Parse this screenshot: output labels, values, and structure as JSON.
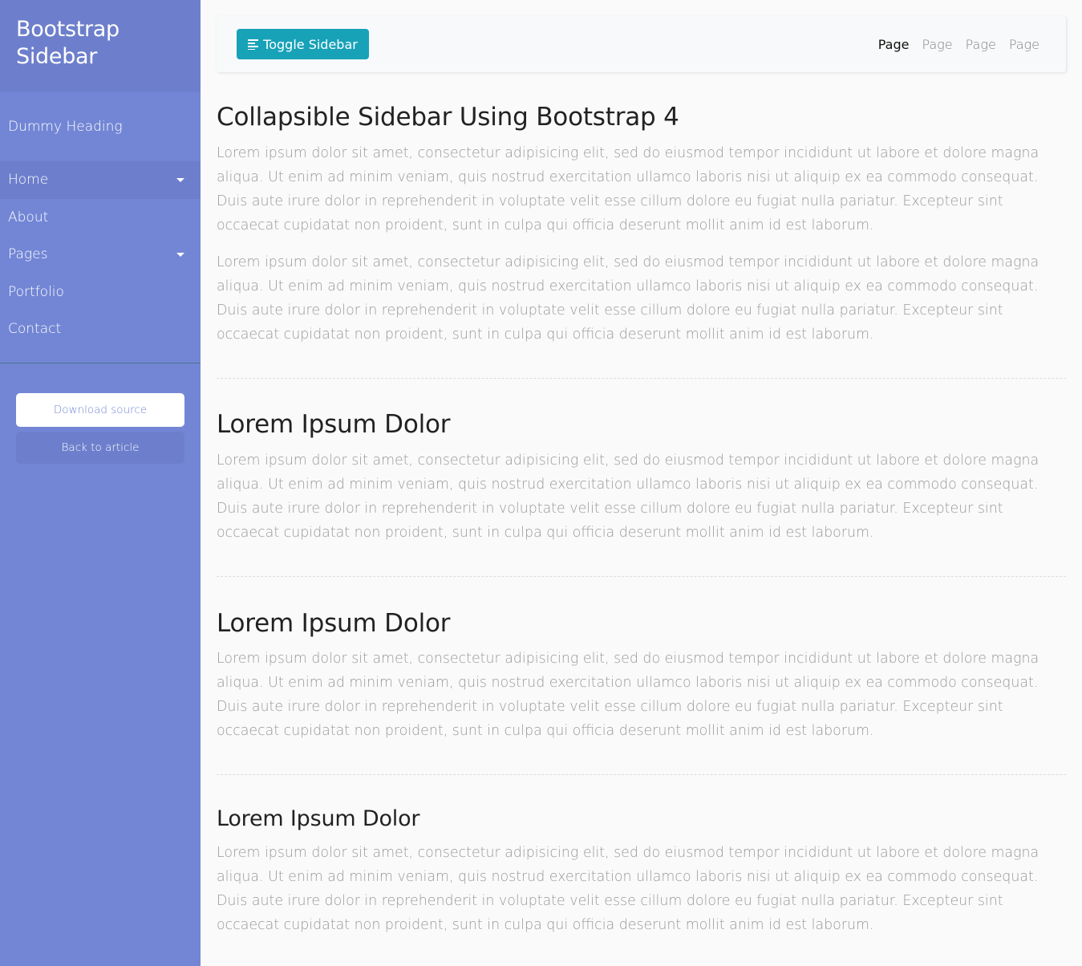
{
  "sidebar": {
    "title": "Bootstrap Sidebar",
    "heading": "Dummy Heading",
    "items": [
      {
        "label": "Home",
        "has_dropdown": true,
        "active": true
      },
      {
        "label": "About",
        "has_dropdown": false,
        "active": false
      },
      {
        "label": "Pages",
        "has_dropdown": true,
        "active": false
      },
      {
        "label": "Portfolio",
        "has_dropdown": false,
        "active": false
      },
      {
        "label": "Contact",
        "has_dropdown": false,
        "active": false
      }
    ],
    "download_label": "Download source",
    "article_label": "Back to article"
  },
  "navbar": {
    "toggle_label": "Toggle Sidebar",
    "links": [
      "Page",
      "Page",
      "Page",
      "Page"
    ]
  },
  "content": {
    "title": "Collapsible Sidebar Using Bootstrap 4",
    "p1": "Lorem ipsum dolor sit amet, consectetur adipisicing elit, sed do eiusmod tempor incididunt ut labore et dolore magna aliqua. Ut enim ad minim veniam, quis nostrud exercitation ullamco laboris nisi ut aliquip ex ea commodo consequat. Duis aute irure dolor in reprehenderit in voluptate velit esse cillum dolore eu fugiat nulla pariatur. Excepteur sint occaecat cupidatat non proident, sunt in culpa qui officia deserunt mollit anim id est laborum.",
    "p2": "Lorem ipsum dolor sit amet, consectetur adipisicing elit, sed do eiusmod tempor incididunt ut labore et dolore magna aliqua. Ut enim ad minim veniam, quis nostrud exercitation ullamco laboris nisi ut aliquip ex ea commodo consequat. Duis aute irure dolor in reprehenderit in voluptate velit esse cillum dolore eu fugiat nulla pariatur. Excepteur sint occaecat cupidatat non proident, sunt in culpa qui officia deserunt mollit anim id est laborum.",
    "sections": [
      {
        "title": "Lorem Ipsum Dolor",
        "text": "Lorem ipsum dolor sit amet, consectetur adipisicing elit, sed do eiusmod tempor incididunt ut labore et dolore magna aliqua. Ut enim ad minim veniam, quis nostrud exercitation ullamco laboris nisi ut aliquip ex ea commodo consequat. Duis aute irure dolor in reprehenderit in voluptate velit esse cillum dolore eu fugiat nulla pariatur. Excepteur sint occaecat cupidatat non proident, sunt in culpa qui officia deserunt mollit anim id est laborum."
      },
      {
        "title": "Lorem Ipsum Dolor",
        "text": "Lorem ipsum dolor sit amet, consectetur adipisicing elit, sed do eiusmod tempor incididunt ut labore et dolore magna aliqua. Ut enim ad minim veniam, quis nostrud exercitation ullamco laboris nisi ut aliquip ex ea commodo consequat. Duis aute irure dolor in reprehenderit in voluptate velit esse cillum dolore eu fugiat nulla pariatur. Excepteur sint occaecat cupidatat non proident, sunt in culpa qui officia deserunt mollit anim id est laborum."
      },
      {
        "title": "Lorem Ipsum Dolor",
        "text": "Lorem ipsum dolor sit amet, consectetur adipisicing elit, sed do eiusmod tempor incididunt ut labore et dolore magna aliqua. Ut enim ad minim veniam, quis nostrud exercitation ullamco laboris nisi ut aliquip ex ea commodo consequat. Duis aute irure dolor in reprehenderit in voluptate velit esse cillum dolore eu fugiat nulla pariatur. Excepteur sint occaecat cupidatat non proident, sunt in culpa qui officia deserunt mollit anim id est laborum."
      }
    ]
  },
  "colors": {
    "sidebar_bg": "#7386d5",
    "sidebar_header_bg": "#6d7fcc",
    "toggle_btn": "#17a2b8",
    "body_text": "#999999"
  },
  "icons": {
    "toggle": "align-left-icon",
    "dropdown": "caret-down-icon"
  }
}
